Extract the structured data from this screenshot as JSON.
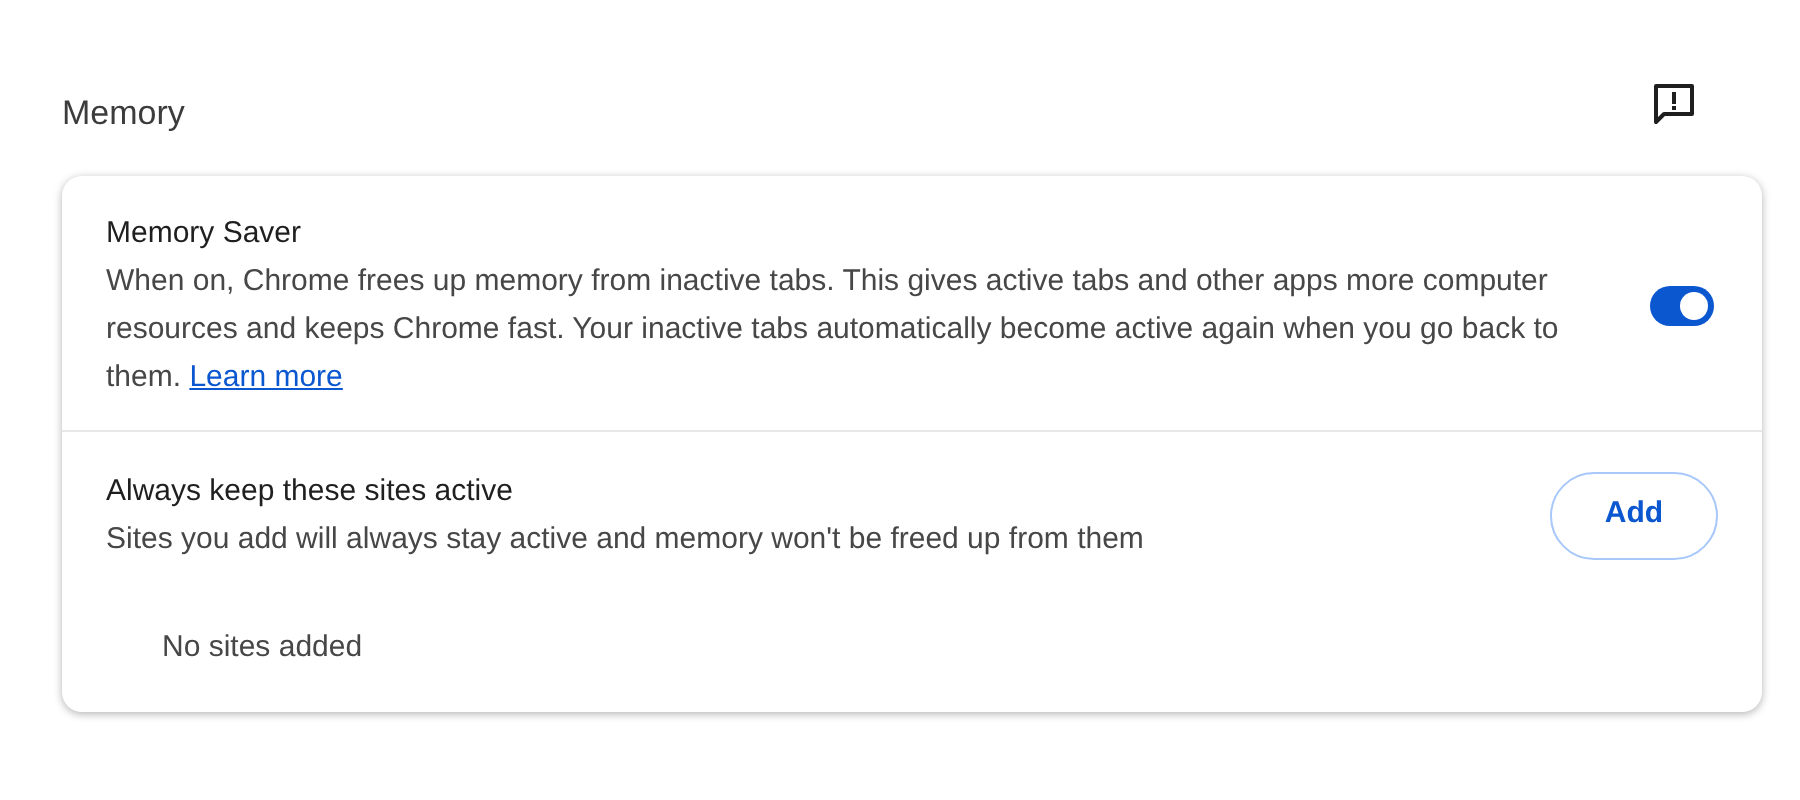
{
  "section": {
    "title": "Memory"
  },
  "memory_saver": {
    "title": "Memory Saver",
    "description": "When on, Chrome frees up memory from inactive tabs. This gives active tabs and other apps more computer resources and keeps Chrome fast. Your inactive tabs automatically become active again when you go back to them.",
    "link": "Learn more",
    "on": true
  },
  "always_active": {
    "title": "Always keep these sites active",
    "description": "Sites you add will always stay active and memory won't be freed up from them",
    "button": "Add",
    "empty_message": "No sites added"
  }
}
